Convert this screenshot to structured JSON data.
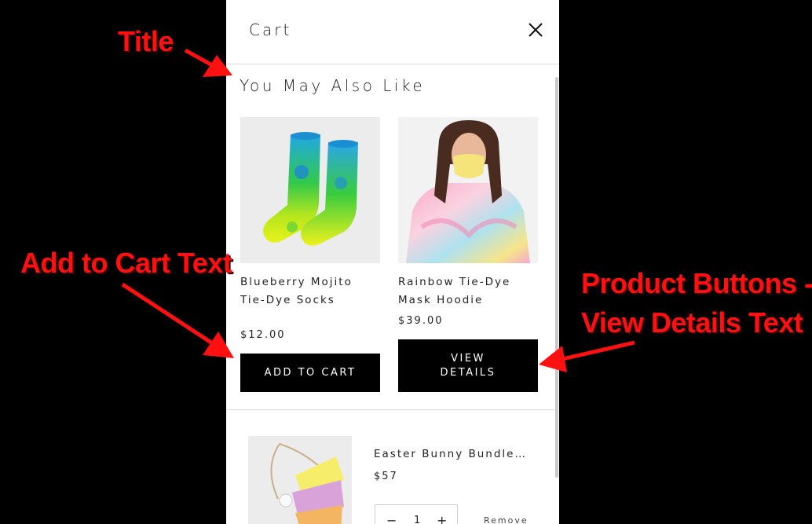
{
  "cart": {
    "title": "Cart",
    "section_title": "You May Also Like",
    "recommendations": [
      {
        "name_line1": "Blueberry Mojito",
        "name_line2": "Tie-Dye Socks",
        "price": "$12.00",
        "button": "ADD TO CART"
      },
      {
        "name_line1": "Rainbow Tie-Dye",
        "name_line2": "Mask Hoodie",
        "price": "$39.00",
        "button_line1": "VIEW",
        "button_line2": "DETAILS"
      }
    ],
    "line_item": {
      "name": "Easter Bunny Bundle…",
      "price": "$57",
      "minus": "−",
      "quantity": "1",
      "plus": "+",
      "remove": "Remove"
    }
  },
  "annotations": {
    "title": "Title",
    "add_to_cart": "Add to Cart Text",
    "product_buttons_line1": "Product Buttons -",
    "product_buttons_line2": "View Details Text",
    "color": "#ff1111"
  }
}
